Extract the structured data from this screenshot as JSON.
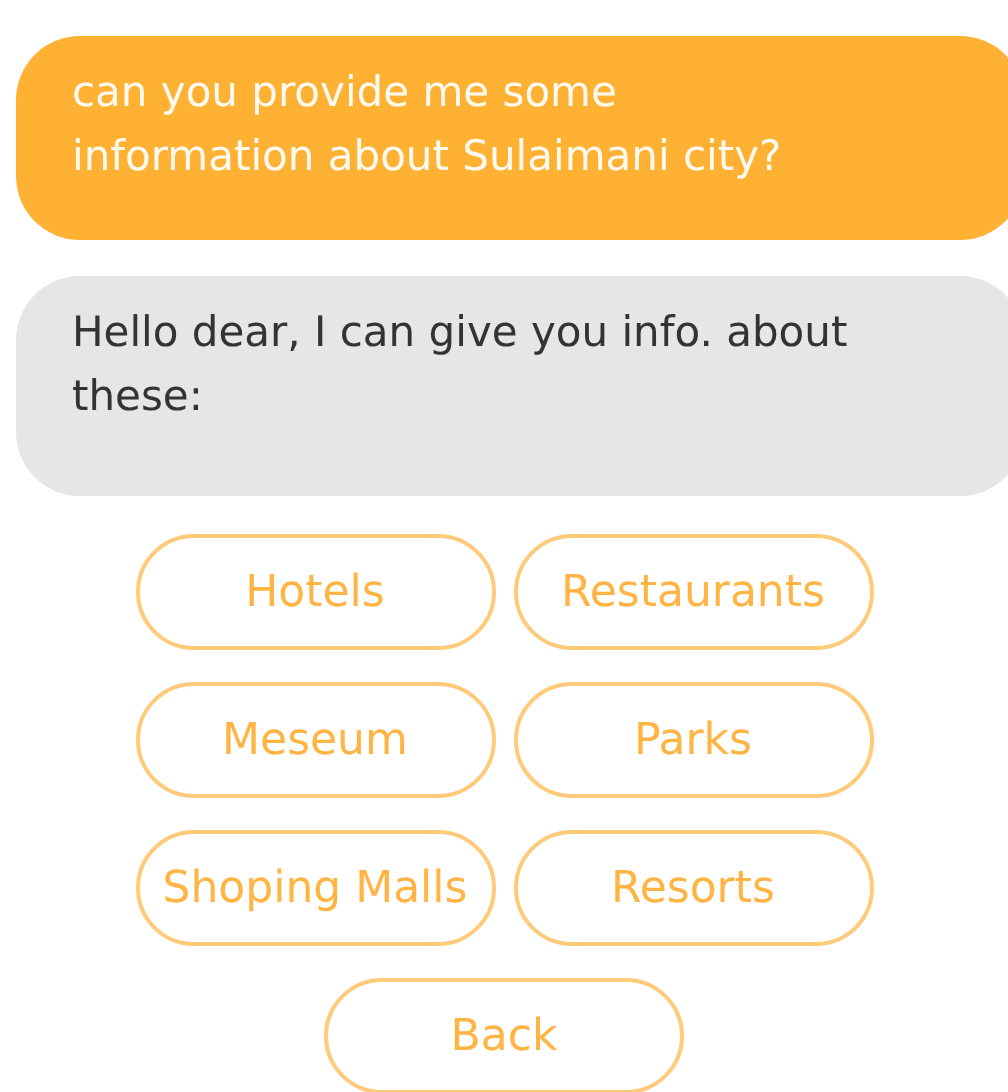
{
  "messages": [
    {
      "kind": "user",
      "text": "can you provide me some information about Sulaimani city?"
    },
    {
      "kind": "bot",
      "text": "Hello dear, I can give you info. about these:"
    }
  ],
  "option_rows": [
    [
      "Hotels",
      "Restaurants"
    ],
    [
      "Meseum",
      "Parks"
    ],
    [
      "Shoping Malls",
      "Resorts"
    ],
    [
      "Back"
    ]
  ]
}
